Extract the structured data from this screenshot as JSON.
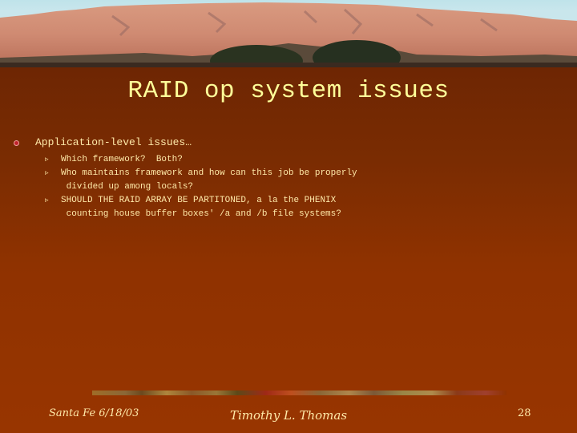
{
  "slide": {
    "title": "RAID op system issues",
    "bullets": [
      {
        "text": "Application-level issues…",
        "sub": [
          {
            "lines": [
              "Which framework?  Both?"
            ]
          },
          {
            "lines": [
              "Who maintains framework and how can this job be properly",
              " divided up among locals?"
            ]
          },
          {
            "lines": [
              "SHOULD THE RAID ARRAY BE PARTITONED, a la the PHENIX",
              " counting house buffer boxes' /a and /b file systems?"
            ]
          }
        ]
      }
    ],
    "sub_bullet_glyph": "▹",
    "footer": {
      "left": "Santa Fe 6/18/03",
      "center": "Timothy L. Thomas",
      "page_number": "28"
    }
  },
  "colors": {
    "title": "#ffff99",
    "body_text": "#ffe9a8",
    "background": "#8f3200",
    "bullet": "#c0222a"
  }
}
